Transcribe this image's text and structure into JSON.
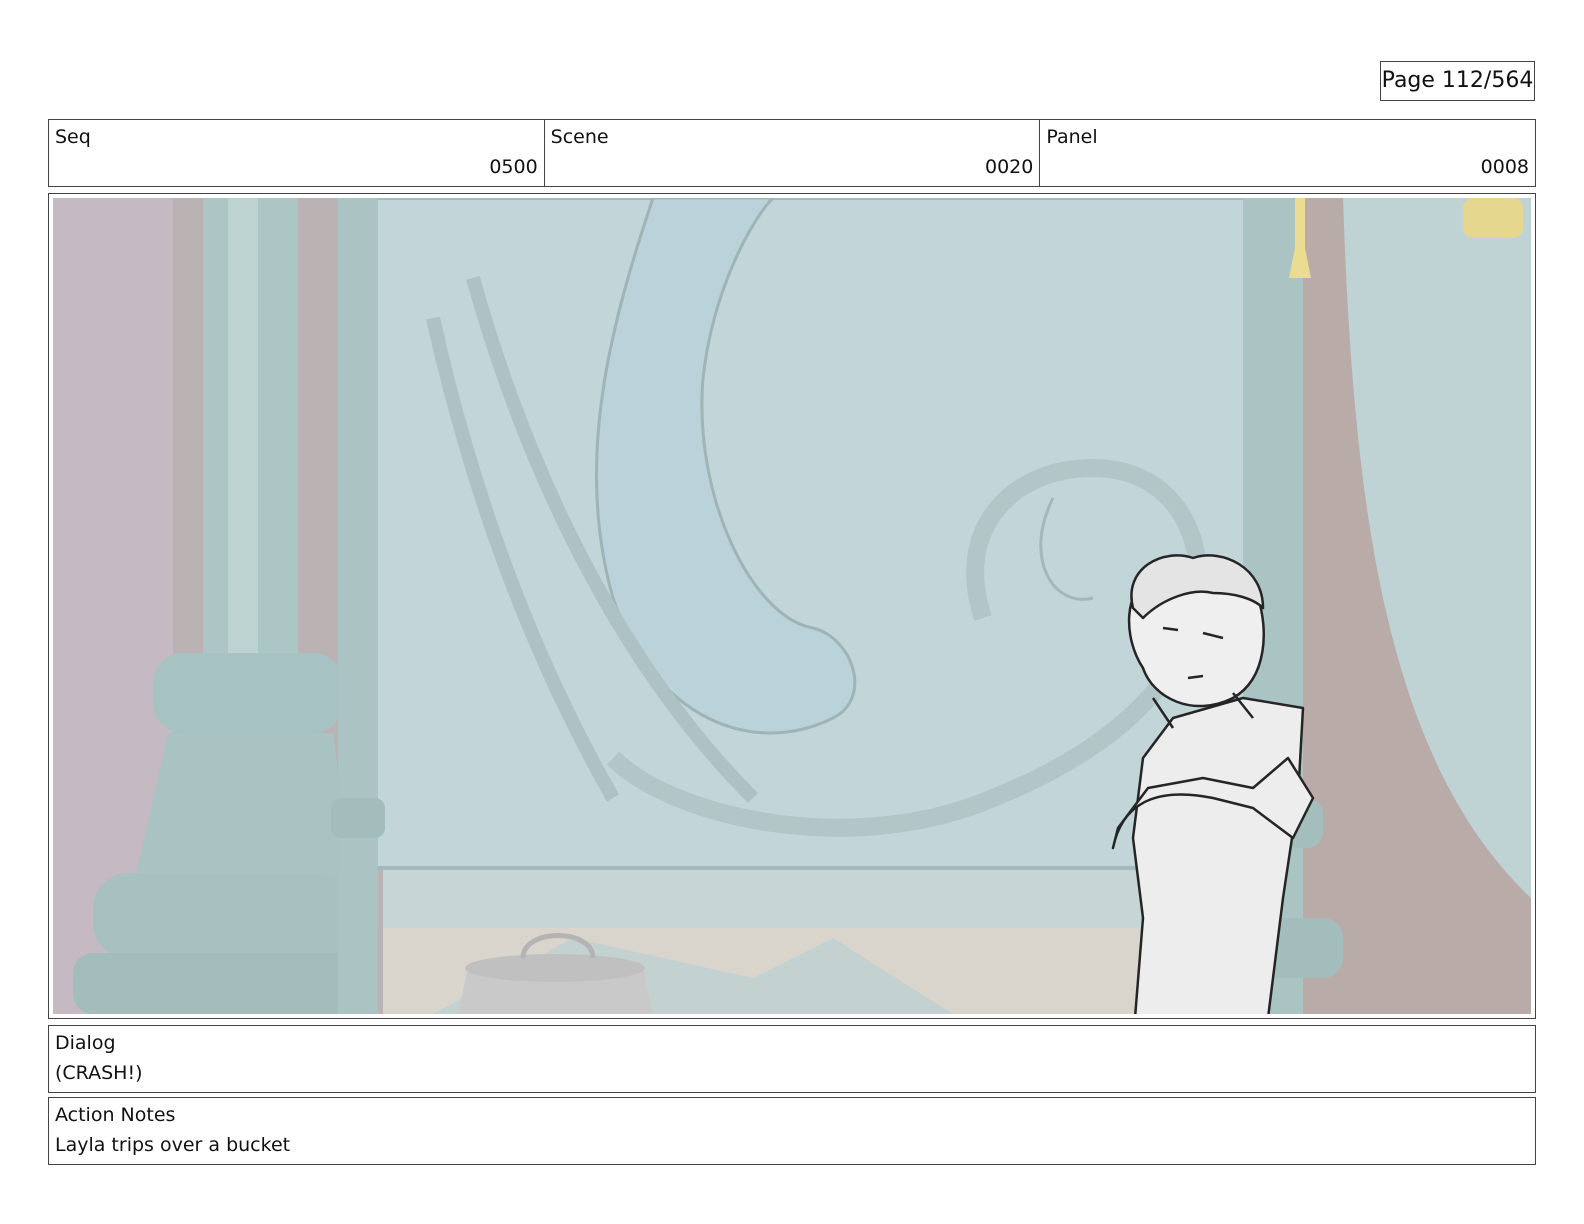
{
  "page": {
    "label": "Page 112/564"
  },
  "meta": {
    "seq": {
      "label": "Seq",
      "value": "0500"
    },
    "scene": {
      "label": "Scene",
      "value": "0020"
    },
    "panel": {
      "label": "Panel",
      "value": "0008"
    }
  },
  "dialog": {
    "label": "Dialog",
    "text": "(CRASH!)"
  },
  "action_notes": {
    "label": "Action Notes",
    "text": "Layla trips over a bucket"
  },
  "colors": {
    "wall": "#bcd0d2",
    "pillar": "#a9c4c4",
    "curtain": "#b7a9a6",
    "floor": "#d9d3cb",
    "sketch": "#1a1a1a"
  }
}
